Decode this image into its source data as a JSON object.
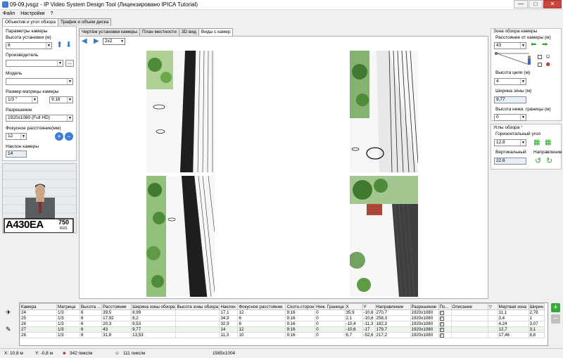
{
  "window": {
    "title": "09-09.jvsgz - IP Video System Design Tool (Лицензировано IPICA Tutorial)",
    "buttons": [
      "—",
      "□",
      "✕"
    ]
  },
  "menu": [
    "Файл",
    "Настройки",
    "?"
  ],
  "top_tabs": [
    "Объектив и угол обзора",
    "Трафик и объем диска"
  ],
  "left": {
    "section_title": "Параметры камеры",
    "height_label": "Высота установки (м)",
    "height_value": "6",
    "manufacturer_label": "Производитель",
    "manufacturer_value": "",
    "browse_label": "...",
    "model_label": "Модель",
    "model_value": "",
    "matrix_label": "Размер матрицы камеры",
    "matrix_value": "1/3 \"",
    "aspect_value": "9:16",
    "resolution_label": "Разрешение",
    "resolution_value": "1920x1080 (Full HD)",
    "focal_label": "Фокусное расстояние(мм)",
    "focal_value": "12",
    "tilt_label": "Наклон камеры",
    "tilt_value": "14",
    "plate_text": "А430ЕА",
    "plate_region": "750",
    "plate_rus": "RUS"
  },
  "center": {
    "tabs": [
      "Чертёж установки камеры",
      "План местности",
      "3D вид",
      "Виды с камер"
    ],
    "layout_value": "2x2"
  },
  "right": {
    "zone_title": "Зона обзора камеры",
    "distance_label": "Расстояние от камеры (м)",
    "distance_value": "43",
    "target_height_label": "Высота цели (м)",
    "target_height_value": "4",
    "zone_width_label": "Ширина зоны (м)",
    "zone_width_value": "9,77",
    "lower_bound_label": "Высота нижн. границы (м)",
    "lower_bound_value": "0",
    "angles_title": "Углы обзора °",
    "horizontal_label": "Горизонтальный угол",
    "horizontal_value": "12,8",
    "vertical_label": "Вертикальный",
    "vertical_value": "22,6",
    "direction_label": "Направление"
  },
  "table": {
    "headers": [
      "Камера",
      "Матрица",
      "Высота ...",
      "Расстояние",
      "Ширина зоны обзора",
      "Высота зоны обзора",
      "Наклон",
      "Фокусное расстояние",
      "Соотн.сторон",
      "Ниж. Граница",
      "X",
      "Y",
      "Направление",
      "Разрешение",
      "По...",
      "Описание",
      "",
      "Мертвая зона",
      "Ширин"
    ],
    "rows": [
      [
        "24",
        "1/3",
        "6",
        "39,5",
        "8,99",
        "",
        "17,1",
        "12",
        "9:16",
        "0",
        "35,9",
        "-10,6",
        "270,7",
        "1920x1080",
        "✓",
        "",
        "",
        "11,1",
        "2,78"
      ],
      [
        "25",
        "1/3",
        "6",
        "17,92",
        "8,2",
        "",
        "34,9",
        "6",
        "9:16",
        "0",
        "2,1",
        "-10,6",
        "258,3",
        "1920x1080",
        "✓",
        "",
        "",
        "3,4",
        "1"
      ],
      [
        "26",
        "1/3",
        "6",
        "20,3",
        "9,53",
        "",
        "32,9",
        "6",
        "9:16",
        "0",
        "-10,4",
        "-11,3",
        "182,3",
        "1920x1080",
        "✓",
        "",
        "",
        "4,24",
        "3,07"
      ],
      [
        "27",
        "1/3",
        "6",
        "43",
        "9,77",
        "",
        "14",
        "12",
        "9:16",
        "0",
        "-10,6",
        "-17",
        "179,7",
        "1920x1080",
        "✓",
        "",
        "",
        "12,7",
        "3,1"
      ],
      [
        "28",
        "1/3",
        "6",
        "31,8",
        "13,53",
        "",
        "11,3",
        "10",
        "9:16",
        "0",
        "6,7",
        "-52,6",
        "217,2",
        "1920x1080",
        "✓",
        "",
        "",
        "17,46",
        "8,8"
      ]
    ]
  },
  "status": {
    "x": "X: 10,8 м",
    "y": "Y: -0,8 м",
    "px1": "342 пикс/м",
    "px2": "111 пикс/м",
    "size": "1565x1004"
  }
}
